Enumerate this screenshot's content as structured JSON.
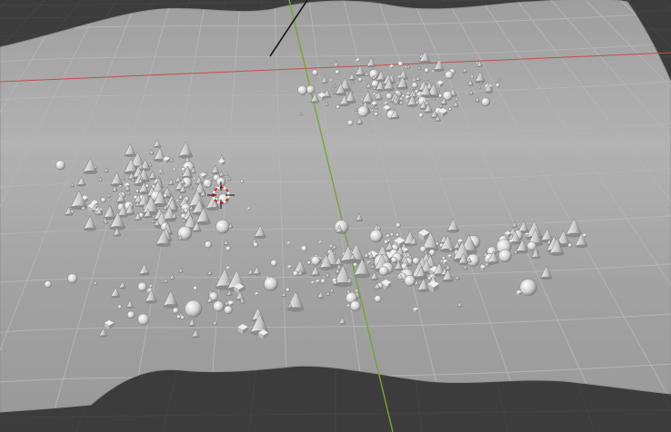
{
  "viewport": {
    "background_color": "#3c3c3c",
    "floor_grid_color": "#444444",
    "terrain_fill_color": "#a9a9a9",
    "terrain_grid_color": "#b4b4b4",
    "x_axis_color": "#c0504d",
    "y_axis_color": "#7aa23a",
    "z_axis_color": "#1a1a1a",
    "scattered_object_shapes": [
      "cone",
      "sphere",
      "cube"
    ],
    "scattered_object_color": "#d8d8d8"
  }
}
